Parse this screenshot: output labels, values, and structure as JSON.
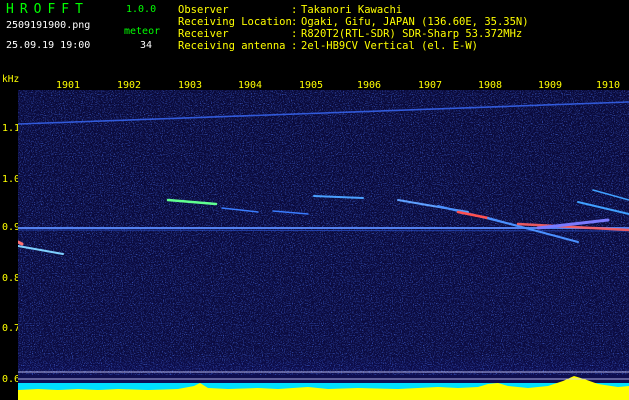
{
  "header": {
    "app_name": "HROFFT",
    "version": "1.0.0",
    "filename": "2509191900.png",
    "datetime": "25.09.19 19:00",
    "meteor_label": "meteor",
    "meteor_count": "34"
  },
  "info": [
    {
      "key": "Observer",
      "value": "Takanori Kawachi"
    },
    {
      "key": "Receiving Location",
      "value": "Ogaki, Gifu, JAPAN (136.60E, 35.35N)"
    },
    {
      "key": "Receiver",
      "value": "R820T2(RTL-SDR) SDR-Sharp 53.372MHz"
    },
    {
      "key": "Receiving antenna",
      "value": "2el-HB9CV Vertical (el. E-W)"
    }
  ],
  "spectrogram": {
    "y_unit": "kHz",
    "x_ticks": [
      "1901",
      "1902",
      "1903",
      "1904",
      "1905",
      "1906",
      "1907",
      "1908",
      "1909",
      "1910"
    ],
    "y_ticks": [
      "1.1",
      "1.0",
      "0.9",
      "0.8",
      "0.7",
      "0.6"
    ],
    "colors": {
      "background": "#0a0a3a",
      "text": "#ffff00",
      "accent": "#00ff00",
      "signal_low": "#2a60ff",
      "signal_high": "#ff4040",
      "noise_floor": "#00e0ff"
    }
  }
}
